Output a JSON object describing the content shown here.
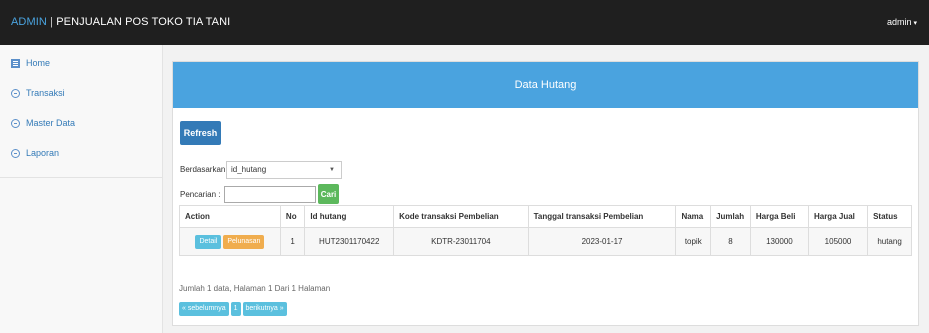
{
  "header": {
    "brand_admin": "ADMIN",
    "brand_sep": " | ",
    "brand_title": "PENJUALAN POS TOKO TIA TANI",
    "user": "admin",
    "user_caret": "▾"
  },
  "sidebar": {
    "items": [
      {
        "label": "Home",
        "icon": "home-icon"
      },
      {
        "label": "Transaksi",
        "icon": "circle-arrow-icon"
      },
      {
        "label": "Master Data",
        "icon": "circle-arrow-icon"
      },
      {
        "label": "Laporan",
        "icon": "circle-arrow-icon"
      }
    ]
  },
  "panel": {
    "title": "Data Hutang",
    "refresh_label": "Refresh",
    "filter_label": "Berdasarkan",
    "filter_selected": "id_hutang",
    "filter_caret": "▼",
    "search_label": "Pencarian",
    "search_value": "",
    "search_button": "Cari"
  },
  "table": {
    "columns": [
      "Action",
      "No",
      "Id hutang",
      "Kode transaksi Pembelian",
      "Tanggal transaksi Pembelian",
      "Nama",
      "Jumlah",
      "Harga Beli",
      "Harga Jual",
      "Status"
    ],
    "rows": [
      {
        "detail": "Detail",
        "pelunasan": "Pelunasan",
        "no": "1",
        "id_hutang": "HUT2301170422",
        "kode": "KDTR-23011704",
        "tanggal": "2023-01-17",
        "nama": "topik",
        "jumlah": "8",
        "harga_beli": "130000",
        "harga_jual": "105000",
        "status": "hutang"
      }
    ]
  },
  "pagination": {
    "info": "Jumlah 1 data, Halaman 1 Dari 1 Halaman",
    "prev": "« sebelumnya",
    "page": "1",
    "next": "berikutnya »"
  },
  "colors": {
    "topbar": "#1f1f1f",
    "accent": "#4aa3df",
    "primary": "#337ab7",
    "success": "#5cb85c",
    "info": "#5bc0de",
    "warning": "#f0ad4e"
  }
}
